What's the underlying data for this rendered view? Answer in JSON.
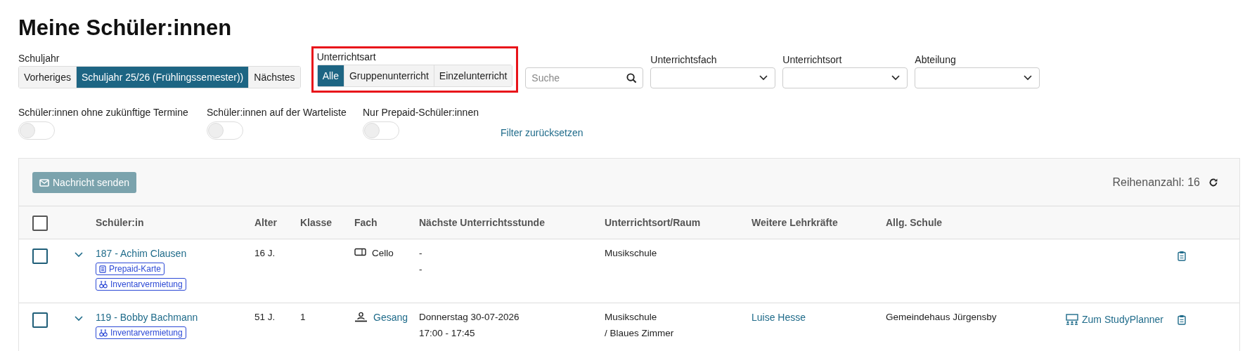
{
  "title": "Meine Schüler:innen",
  "filters": {
    "school_year": {
      "label": "Schuljahr",
      "options": [
        {
          "label": "Vorheriges",
          "selected": false
        },
        {
          "label": "Schuljahr 25/26 (Frühlingssemester))",
          "selected": true
        },
        {
          "label": "Nächstes",
          "selected": false
        }
      ]
    },
    "lesson_type": {
      "label": "Unterrichtsart",
      "highlighted": true,
      "options": [
        {
          "label": "Alle",
          "selected": true
        },
        {
          "label": "Gruppenunterricht",
          "selected": false
        },
        {
          "label": "Einzelunterricht",
          "selected": false
        }
      ]
    },
    "search": {
      "placeholder": "Suche"
    },
    "dropdowns": [
      {
        "label": "Unterrichtsfach"
      },
      {
        "label": "Unterrichtsort"
      },
      {
        "label": "Abteilung"
      }
    ],
    "toggles": [
      {
        "label": "Schüler:innen ohne zukünftige Termine",
        "on": false
      },
      {
        "label": "Schüler:innen auf der Warteliste",
        "on": false
      },
      {
        "label": "Nur Prepaid-Schüler:innen",
        "on": false
      }
    ],
    "reset": "Filter zurücksetzen"
  },
  "table": {
    "send_button": "Nachricht senden",
    "row_count": "Reihenanzahl: 16",
    "columns": [
      "Schüler:in",
      "Alter",
      "Klasse",
      "Fach",
      "Nächste Unterrichtsstunde",
      "Unterrichtsort/Raum",
      "Weitere Lehrkräfte",
      "Allg. Schule"
    ],
    "select_all": false,
    "rows": [
      {
        "checked": false,
        "expanded": false,
        "student": "187 - Achim Clausen",
        "tags": [
          {
            "kind": "prepaid",
            "label": "Prepaid-Karte"
          },
          {
            "kind": "rental",
            "label": "Inventarvermietung"
          }
        ],
        "age": "16 J.",
        "class": "",
        "subject": {
          "kind": "group",
          "label": "Cello",
          "linked": false
        },
        "next": [
          "-",
          "-"
        ],
        "location": [
          "Musikschule"
        ],
        "teachers": "",
        "school": "",
        "planner": ""
      },
      {
        "checked": false,
        "expanded": false,
        "student": "119 - Bobby Bachmann",
        "tags": [
          {
            "kind": "rental",
            "label": "Inventarvermietung"
          }
        ],
        "age": "51 J.",
        "class": "1",
        "subject": {
          "kind": "single",
          "label": "Gesang",
          "linked": true
        },
        "next": [
          "Donnerstag 30-07-2026",
          "17:00 - 17:45"
        ],
        "location": [
          "Musikschule",
          "/ Blaues Zimmer"
        ],
        "teachers": "Luise Hesse",
        "school": "Gemeindehaus Jürgensby",
        "planner": "Zum StudyPlanner"
      }
    ]
  }
}
